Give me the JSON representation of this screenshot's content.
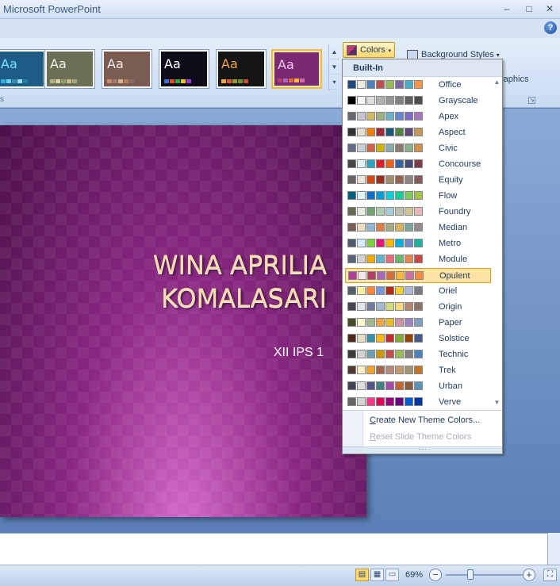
{
  "window": {
    "title": "Microsoft PowerPoint",
    "minimize_glyph": "–",
    "maximize_glyph": "□",
    "close_glyph": "✕",
    "help_glyph": "?"
  },
  "ribbon": {
    "colors_button": {
      "label": "Colors",
      "arrow": "▾"
    },
    "background_styles": {
      "label": "Background Styles",
      "arrow": "▾"
    },
    "graphics_label": "raphics",
    "group_label_fragment": "s",
    "launcher_glyph": "↘",
    "gallery_up": "▲",
    "gallery_down": "▼",
    "gallery_more": "▾",
    "theme_glyph": "Aa",
    "themes": [
      {
        "bg": "#1c5c86",
        "text_color": "#7ee0ff",
        "bars": [
          "#2fb2d6",
          "#6bd3ee",
          "#3a8ab0",
          "#9bdcf0",
          "#1f7ea3"
        ]
      },
      {
        "bg": "#6b6f55",
        "text_color": "#f2f2e8",
        "bars": [
          "#b3b48a",
          "#d7d2a0",
          "#8f9b6b",
          "#c9c08a",
          "#a7a57b"
        ]
      },
      {
        "bg": "#7a5c52",
        "text_color": "#f3ece7",
        "bars": [
          "#c98c6a",
          "#a27a6d",
          "#d3b38d",
          "#b67a5c",
          "#8a6a60"
        ]
      },
      {
        "bg": "#0d0d1a",
        "text_color": "#ffffff",
        "bars": [
          "#3f6fd1",
          "#e94e1b",
          "#37a33f",
          "#f2c21b",
          "#9b3ec9"
        ]
      },
      {
        "bg": "#151515",
        "text_color": "#f3a640",
        "bars": [
          "#f3a640",
          "#d85a2a",
          "#9a9a2a",
          "#6b8f2d",
          "#c9502c"
        ]
      },
      {
        "bg": "#7a2a72",
        "text_color": "#f0c7e8",
        "bars": [
          "#b83d68",
          "#ac66bb",
          "#de6c36",
          "#f9b639",
          "#cf6da4"
        ]
      }
    ]
  },
  "colors_dropdown": {
    "header": "Built-In",
    "selected": "Opulent",
    "scroll_up": "▲",
    "scroll_down": "▼",
    "grip": "····",
    "create_label": "Create New Theme Colors...",
    "create_accel": "C",
    "reset_label": "Reset Slide Theme Colors",
    "reset_accel": "R",
    "items": [
      {
        "name": "Office",
        "colors": [
          "#1f497d",
          "#eeece1",
          "#4f81bd",
          "#c0504d",
          "#9bbb59",
          "#8064a2",
          "#4bacc6",
          "#f79646"
        ]
      },
      {
        "name": "Grayscale",
        "colors": [
          "#000000",
          "#f8f8f8",
          "#dddddd",
          "#b2b2b2",
          "#969696",
          "#808080",
          "#5f5f5f",
          "#4d4d4d"
        ]
      },
      {
        "name": "Apex",
        "colors": [
          "#69676d",
          "#c9c2d1",
          "#ceb966",
          "#9cb084",
          "#6bb1c9",
          "#6585cf",
          "#7e6bc9",
          "#a379bb"
        ]
      },
      {
        "name": "Aspect",
        "colors": [
          "#323232",
          "#e3ded1",
          "#f07f09",
          "#9f2936",
          "#1b587c",
          "#4e8542",
          "#604878",
          "#c19859"
        ]
      },
      {
        "name": "Civic",
        "colors": [
          "#646b86",
          "#c5d1d7",
          "#d16349",
          "#ccb400",
          "#8cadae",
          "#8c7b70",
          "#8fb08c",
          "#d19049"
        ]
      },
      {
        "name": "Concourse",
        "colors": [
          "#464646",
          "#def5fa",
          "#2da2bf",
          "#da1f28",
          "#eb641b",
          "#39639d",
          "#474b78",
          "#7d3c4a"
        ]
      },
      {
        "name": "Equity",
        "colors": [
          "#696464",
          "#e9e5dc",
          "#d34817",
          "#9b2d1f",
          "#a28e6a",
          "#956251",
          "#918485",
          "#855d5d"
        ]
      },
      {
        "name": "Flow",
        "colors": [
          "#04617b",
          "#dbf5f9",
          "#0f6fc6",
          "#009dd9",
          "#0bd0d9",
          "#10cf9b",
          "#7cca62",
          "#a5c249"
        ]
      },
      {
        "name": "Foundry",
        "colors": [
          "#676a55",
          "#eaebde",
          "#72a376",
          "#b0ccb0",
          "#a8cdd7",
          "#c0beaf",
          "#cec597",
          "#e8b7b7"
        ]
      },
      {
        "name": "Median",
        "colors": [
          "#775f55",
          "#ebddc3",
          "#94b6d2",
          "#dd8047",
          "#a5ab81",
          "#d8b25c",
          "#7ba79d",
          "#968c8c"
        ]
      },
      {
        "name": "Metro",
        "colors": [
          "#4e5b6f",
          "#d6ecff",
          "#7fd13b",
          "#ea157a",
          "#feb80a",
          "#00addc",
          "#738ac8",
          "#1ab39f"
        ]
      },
      {
        "name": "Module",
        "colors": [
          "#5a6378",
          "#d4d4d4",
          "#f0ad00",
          "#60b5cc",
          "#e66c7d",
          "#6bb76d",
          "#e88651",
          "#c64847"
        ]
      },
      {
        "name": "Opulent",
        "colors": [
          "#b13f9a",
          "#f4e7ed",
          "#b83d68",
          "#ac66bb",
          "#de6c36",
          "#f9b639",
          "#cf6da4",
          "#fa8d3d"
        ]
      },
      {
        "name": "Oriel",
        "colors": [
          "#575f6d",
          "#fff39d",
          "#fe8637",
          "#7598d9",
          "#b32c16",
          "#f5cd2d",
          "#aebad5",
          "#777c84"
        ]
      },
      {
        "name": "Origin",
        "colors": [
          "#464653",
          "#dde9ec",
          "#727ca3",
          "#9fb8cd",
          "#d2da7a",
          "#fada7a",
          "#b88472",
          "#8e736a"
        ]
      },
      {
        "name": "Paper",
        "colors": [
          "#444d26",
          "#fefac9",
          "#a5b592",
          "#f3a447",
          "#e7bc29",
          "#d092a7",
          "#9c85c0",
          "#809ec2"
        ]
      },
      {
        "name": "Solstice",
        "colors": [
          "#4f271c",
          "#e7dec9",
          "#3891a7",
          "#feb80a",
          "#c32d2e",
          "#84aa33",
          "#964305",
          "#475a8d"
        ]
      },
      {
        "name": "Technic",
        "colors": [
          "#3b3b3b",
          "#d4d2d0",
          "#6ea0b0",
          "#cc9900",
          "#c0504d",
          "#9bbb59",
          "#7f7f7f",
          "#4f81bd"
        ]
      },
      {
        "name": "Trek",
        "colors": [
          "#4e3b30",
          "#fbeec9",
          "#f0a22e",
          "#a5644e",
          "#b58b80",
          "#c3986d",
          "#a19574",
          "#c17529"
        ]
      },
      {
        "name": "Urban",
        "colors": [
          "#424456",
          "#dedede",
          "#53548a",
          "#438086",
          "#a04da3",
          "#c4652d",
          "#8b5d3d",
          "#5c92b5"
        ]
      },
      {
        "name": "Verve",
        "colors": [
          "#666666",
          "#d2d2d2",
          "#ff388c",
          "#e40059",
          "#9c007f",
          "#68007f",
          "#005bd3",
          "#00349e"
        ]
      }
    ]
  },
  "slide": {
    "title_line1": "WINA APRILIA",
    "title_line2": "KOMALASARI",
    "subtitle": "XII IPS 1"
  },
  "statusbar": {
    "zoom": "69%",
    "zoom_out": "−",
    "zoom_in": "+",
    "view_normal": "▤",
    "view_sorter": "▦",
    "view_show": "▭",
    "fit": "⛶"
  }
}
